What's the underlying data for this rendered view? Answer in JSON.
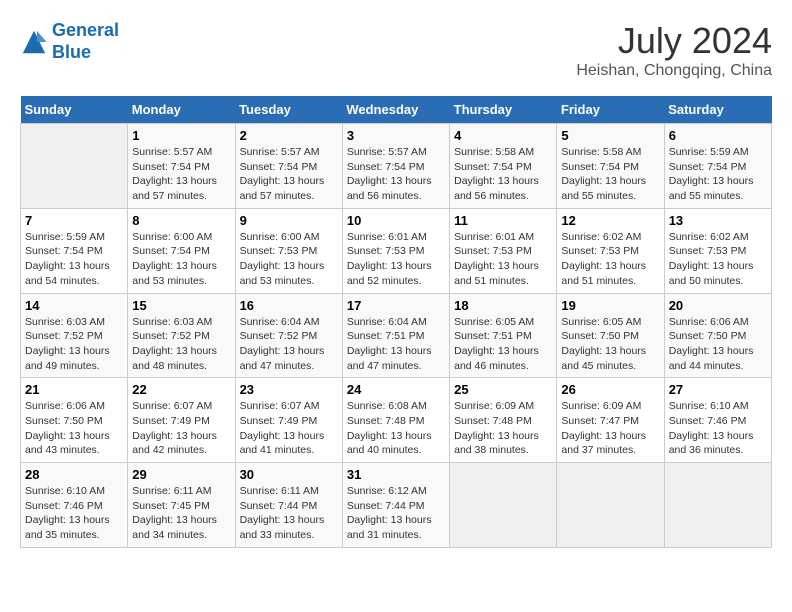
{
  "header": {
    "logo_line1": "General",
    "logo_line2": "Blue",
    "main_title": "July 2024",
    "subtitle": "Heishan, Chongqing, China"
  },
  "calendar": {
    "columns": [
      "Sunday",
      "Monday",
      "Tuesday",
      "Wednesday",
      "Thursday",
      "Friday",
      "Saturday"
    ],
    "weeks": [
      [
        {
          "num": "",
          "info": ""
        },
        {
          "num": "1",
          "info": "Sunrise: 5:57 AM\nSunset: 7:54 PM\nDaylight: 13 hours\nand 57 minutes."
        },
        {
          "num": "2",
          "info": "Sunrise: 5:57 AM\nSunset: 7:54 PM\nDaylight: 13 hours\nand 57 minutes."
        },
        {
          "num": "3",
          "info": "Sunrise: 5:57 AM\nSunset: 7:54 PM\nDaylight: 13 hours\nand 56 minutes."
        },
        {
          "num": "4",
          "info": "Sunrise: 5:58 AM\nSunset: 7:54 PM\nDaylight: 13 hours\nand 56 minutes."
        },
        {
          "num": "5",
          "info": "Sunrise: 5:58 AM\nSunset: 7:54 PM\nDaylight: 13 hours\nand 55 minutes."
        },
        {
          "num": "6",
          "info": "Sunrise: 5:59 AM\nSunset: 7:54 PM\nDaylight: 13 hours\nand 55 minutes."
        }
      ],
      [
        {
          "num": "7",
          "info": "Sunrise: 5:59 AM\nSunset: 7:54 PM\nDaylight: 13 hours\nand 54 minutes."
        },
        {
          "num": "8",
          "info": "Sunrise: 6:00 AM\nSunset: 7:54 PM\nDaylight: 13 hours\nand 53 minutes."
        },
        {
          "num": "9",
          "info": "Sunrise: 6:00 AM\nSunset: 7:53 PM\nDaylight: 13 hours\nand 53 minutes."
        },
        {
          "num": "10",
          "info": "Sunrise: 6:01 AM\nSunset: 7:53 PM\nDaylight: 13 hours\nand 52 minutes."
        },
        {
          "num": "11",
          "info": "Sunrise: 6:01 AM\nSunset: 7:53 PM\nDaylight: 13 hours\nand 51 minutes."
        },
        {
          "num": "12",
          "info": "Sunrise: 6:02 AM\nSunset: 7:53 PM\nDaylight: 13 hours\nand 51 minutes."
        },
        {
          "num": "13",
          "info": "Sunrise: 6:02 AM\nSunset: 7:53 PM\nDaylight: 13 hours\nand 50 minutes."
        }
      ],
      [
        {
          "num": "14",
          "info": "Sunrise: 6:03 AM\nSunset: 7:52 PM\nDaylight: 13 hours\nand 49 minutes."
        },
        {
          "num": "15",
          "info": "Sunrise: 6:03 AM\nSunset: 7:52 PM\nDaylight: 13 hours\nand 48 minutes."
        },
        {
          "num": "16",
          "info": "Sunrise: 6:04 AM\nSunset: 7:52 PM\nDaylight: 13 hours\nand 47 minutes."
        },
        {
          "num": "17",
          "info": "Sunrise: 6:04 AM\nSunset: 7:51 PM\nDaylight: 13 hours\nand 47 minutes."
        },
        {
          "num": "18",
          "info": "Sunrise: 6:05 AM\nSunset: 7:51 PM\nDaylight: 13 hours\nand 46 minutes."
        },
        {
          "num": "19",
          "info": "Sunrise: 6:05 AM\nSunset: 7:50 PM\nDaylight: 13 hours\nand 45 minutes."
        },
        {
          "num": "20",
          "info": "Sunrise: 6:06 AM\nSunset: 7:50 PM\nDaylight: 13 hours\nand 44 minutes."
        }
      ],
      [
        {
          "num": "21",
          "info": "Sunrise: 6:06 AM\nSunset: 7:50 PM\nDaylight: 13 hours\nand 43 minutes."
        },
        {
          "num": "22",
          "info": "Sunrise: 6:07 AM\nSunset: 7:49 PM\nDaylight: 13 hours\nand 42 minutes."
        },
        {
          "num": "23",
          "info": "Sunrise: 6:07 AM\nSunset: 7:49 PM\nDaylight: 13 hours\nand 41 minutes."
        },
        {
          "num": "24",
          "info": "Sunrise: 6:08 AM\nSunset: 7:48 PM\nDaylight: 13 hours\nand 40 minutes."
        },
        {
          "num": "25",
          "info": "Sunrise: 6:09 AM\nSunset: 7:48 PM\nDaylight: 13 hours\nand 38 minutes."
        },
        {
          "num": "26",
          "info": "Sunrise: 6:09 AM\nSunset: 7:47 PM\nDaylight: 13 hours\nand 37 minutes."
        },
        {
          "num": "27",
          "info": "Sunrise: 6:10 AM\nSunset: 7:46 PM\nDaylight: 13 hours\nand 36 minutes."
        }
      ],
      [
        {
          "num": "28",
          "info": "Sunrise: 6:10 AM\nSunset: 7:46 PM\nDaylight: 13 hours\nand 35 minutes."
        },
        {
          "num": "29",
          "info": "Sunrise: 6:11 AM\nSunset: 7:45 PM\nDaylight: 13 hours\nand 34 minutes."
        },
        {
          "num": "30",
          "info": "Sunrise: 6:11 AM\nSunset: 7:44 PM\nDaylight: 13 hours\nand 33 minutes."
        },
        {
          "num": "31",
          "info": "Sunrise: 6:12 AM\nSunset: 7:44 PM\nDaylight: 13 hours\nand 31 minutes."
        },
        {
          "num": "",
          "info": ""
        },
        {
          "num": "",
          "info": ""
        },
        {
          "num": "",
          "info": ""
        }
      ]
    ]
  }
}
